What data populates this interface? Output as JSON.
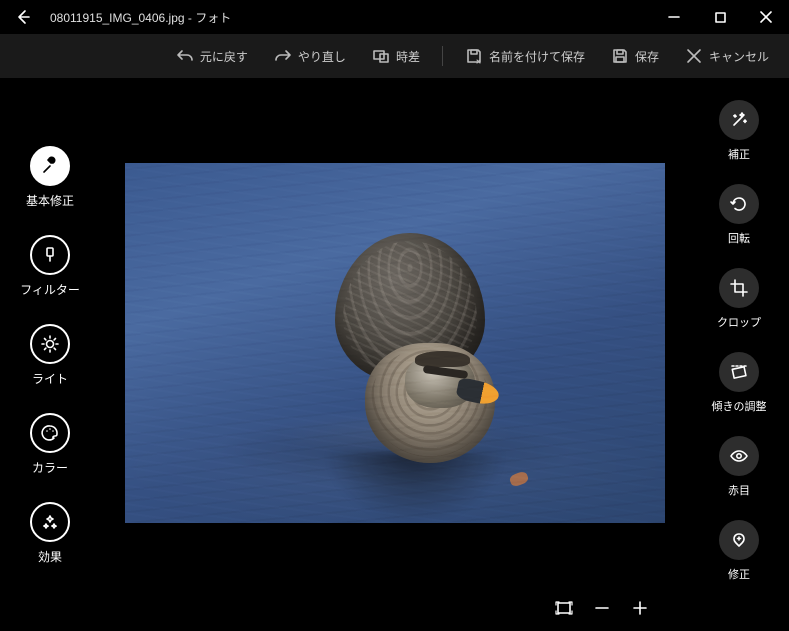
{
  "titlebar": {
    "title": "08011915_IMG_0406.jpg - フォト"
  },
  "toolbar": {
    "undo": "元に戻す",
    "redo": "やり直し",
    "compare": "時差",
    "save_as": "名前を付けて保存",
    "save": "保存",
    "cancel": "キャンセル"
  },
  "left_tools": {
    "basic_fix": "基本修正",
    "filter": "フィルター",
    "light": "ライト",
    "color": "カラー",
    "effect": "効果"
  },
  "right_tools": {
    "enhance": "補正",
    "rotate": "回転",
    "crop": "クロップ",
    "straighten": "傾きの調整",
    "redeye": "赤目",
    "retouch": "修正"
  }
}
